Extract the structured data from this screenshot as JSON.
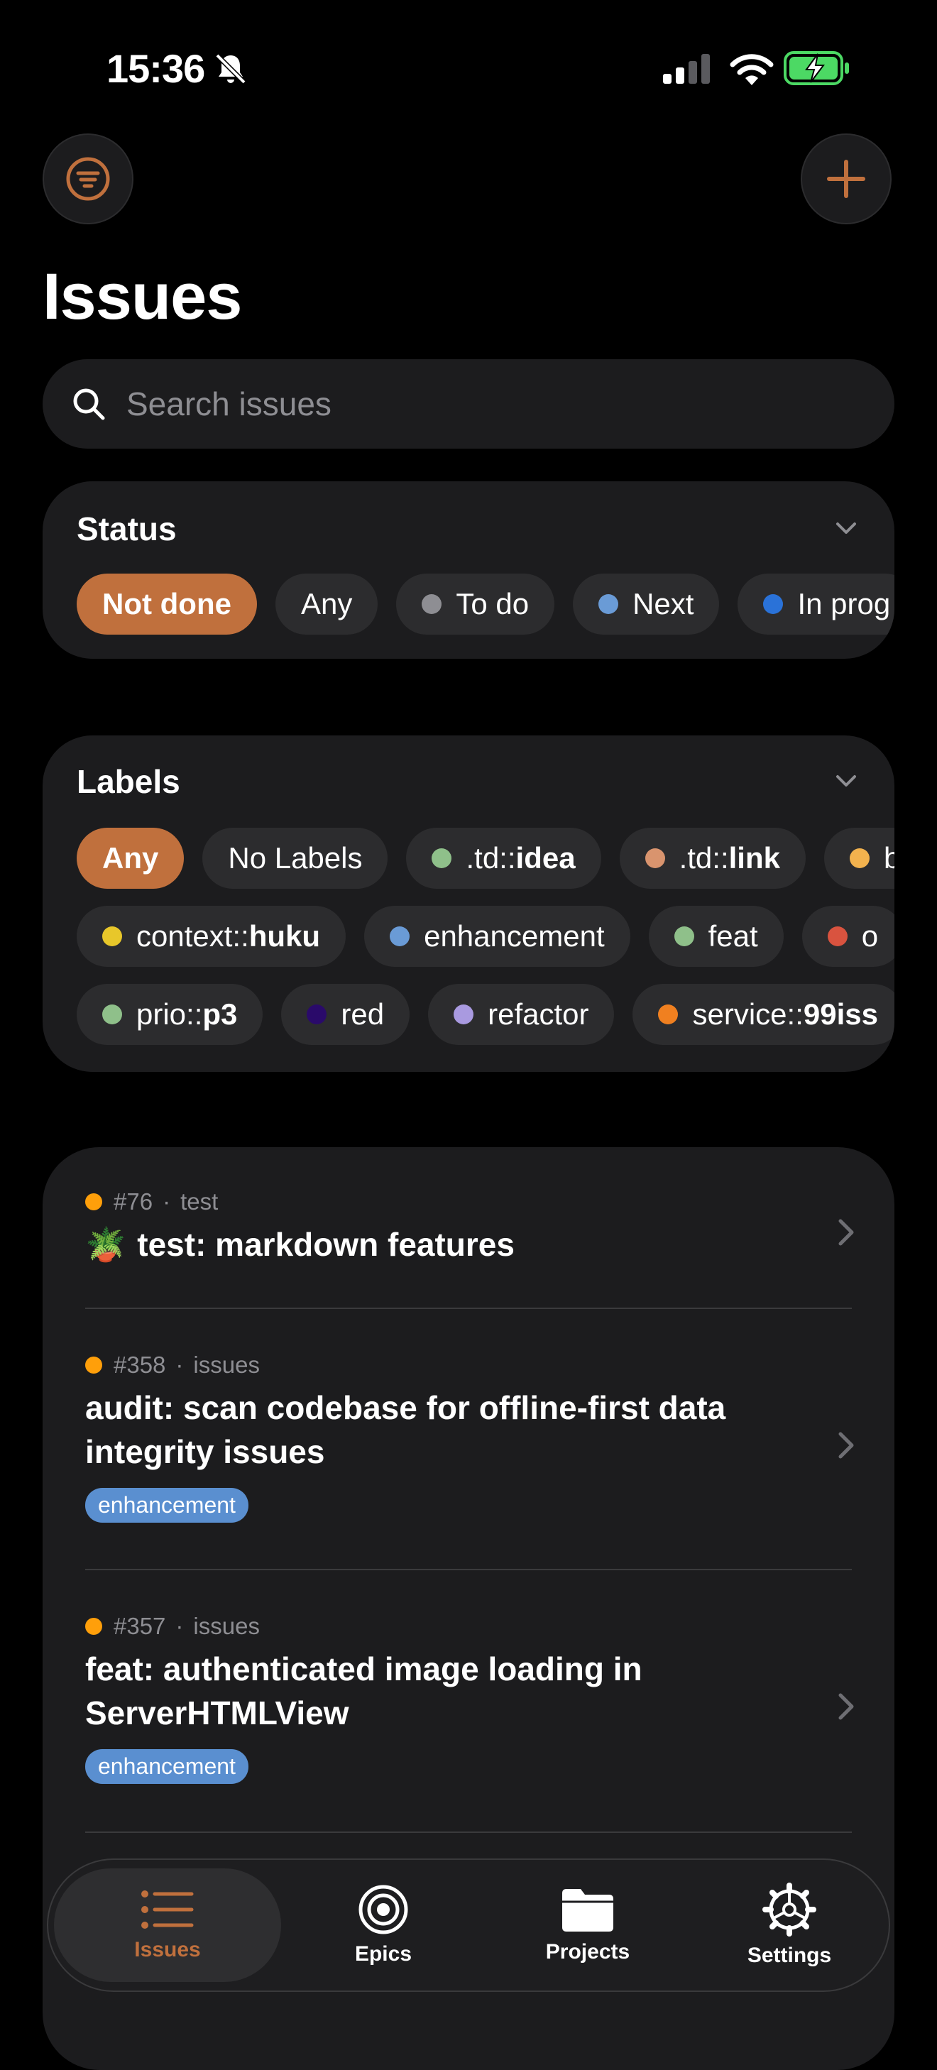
{
  "status_bar": {
    "time": "15:36"
  },
  "header": {
    "title": "Issues"
  },
  "search": {
    "placeholder": "Search issues"
  },
  "colors": {
    "accent": "#c0703d",
    "card": "#1c1c1e",
    "chip": "#2c2c2e",
    "tag": "#5a8fd0"
  },
  "status_filter": {
    "title": "Status",
    "chips": [
      {
        "label": "Not done",
        "selected": true,
        "dot": null
      },
      {
        "label": "Any",
        "selected": false,
        "dot": null
      },
      {
        "label": "To do",
        "selected": false,
        "dot": "#8e8e93"
      },
      {
        "label": "Next",
        "selected": false,
        "dot": "#6a9bd6"
      },
      {
        "label": "In prog",
        "selected": false,
        "dot": "#2a72d8"
      }
    ]
  },
  "labels_filter": {
    "title": "Labels",
    "rows": [
      [
        {
          "prefix": "Any",
          "bold": "",
          "dot": null,
          "selected": true
        },
        {
          "prefix": "No Labels",
          "bold": "",
          "dot": null,
          "selected": false
        },
        {
          "prefix": ".td::",
          "bold": "idea",
          "dot": "#8fc08a",
          "selected": false
        },
        {
          "prefix": ".td::",
          "bold": "link",
          "dot": "#d9946e",
          "selected": false
        },
        {
          "prefix": "b",
          "bold": "",
          "dot": "#f2b24e",
          "selected": false
        }
      ],
      [
        {
          "prefix": "context::",
          "bold": "huku",
          "dot": "#e8c72a",
          "selected": false
        },
        {
          "prefix": "enhancement",
          "bold": "",
          "dot": "#6a9bd6",
          "selected": false
        },
        {
          "prefix": "feat",
          "bold": "",
          "dot": "#8fc08a",
          "selected": false
        },
        {
          "prefix": "o",
          "bold": "",
          "dot": "#d9533f",
          "selected": false
        }
      ],
      [
        {
          "prefix": "prio::",
          "bold": "p3",
          "dot": "#8fc08a",
          "selected": false
        },
        {
          "prefix": "red",
          "bold": "",
          "dot": "#2a0a6a",
          "selected": false
        },
        {
          "prefix": "refactor",
          "bold": "",
          "dot": "#a99ae0",
          "selected": false
        },
        {
          "prefix": "service::",
          "bold": "99iss",
          "dot": "#f08020",
          "selected": false
        }
      ]
    ]
  },
  "issues": [
    {
      "number": "#76",
      "project": "test",
      "emoji": "🪴",
      "title": "test: markdown features",
      "tag": "",
      "dot": "#ff9f0a"
    },
    {
      "number": "#358",
      "project": "issues",
      "emoji": "",
      "title": "audit: scan codebase for offline-first data integrity issues",
      "tag": "enhancement",
      "dot": "#ff9f0a"
    },
    {
      "number": "#357",
      "project": "issues",
      "emoji": "",
      "title": "feat: authenticated image loading in ServerHTMLView",
      "tag": "enhancement",
      "dot": "#ff9f0a"
    }
  ],
  "tabbar": {
    "issues": "Issues",
    "epics": "Epics",
    "projects": "Projects",
    "settings": "Settings"
  }
}
